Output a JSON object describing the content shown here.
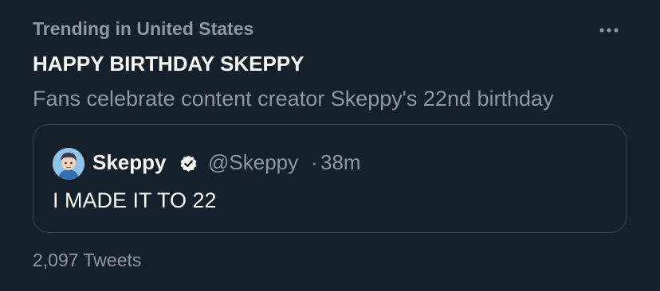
{
  "trend": {
    "context": "Trending in United States",
    "title": "HAPPY BIRTHDAY SKEPPY",
    "description": "Fans celebrate content creator Skeppy's 22nd birthday",
    "tweet_count": "2,097 Tweets",
    "more_icon": "more-horizontal-icon"
  },
  "quote": {
    "author_name": "Skeppy",
    "handle": "@Skeppy",
    "separator": "·",
    "time": "38m",
    "text": "I MADE IT TO 22",
    "verified_icon": "verified-badge-icon"
  },
  "colors": {
    "background": "#15202b",
    "primary_text": "#f7f9f9",
    "secondary_text": "#8b98a5",
    "border": "#38444d"
  }
}
